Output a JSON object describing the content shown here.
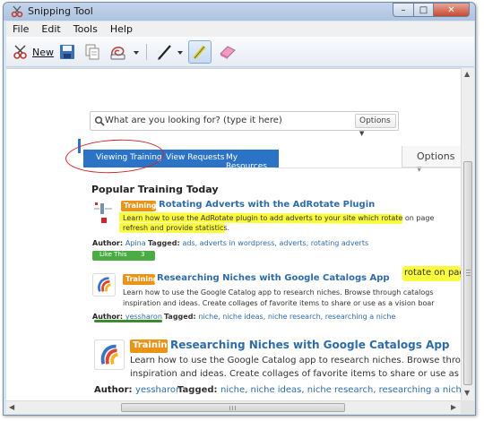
{
  "window": {
    "title": "Snipping Tool"
  },
  "menu": [
    "File",
    "Edit",
    "Tools",
    "Help"
  ],
  "toolbar": {
    "new_label": "New"
  },
  "search": {
    "placeholder": "What are you looking for? (type it here)",
    "options_label": "Options"
  },
  "tabs": [
    "Viewing Training",
    "View Requests",
    "My Resources"
  ],
  "right_options_label": "Options",
  "section_title": "Popular Training Today",
  "trainings": [
    {
      "badge": "Training",
      "title": "Rotating Adverts with the AdRotate Plugin",
      "desc_lines": [
        "Learn how to use the AdRotate plugin to add adverts to your site which rotate on page",
        "refresh and provide statistics."
      ],
      "author_label": "Author:",
      "author": "Apina",
      "tagged_label": "Tagged:",
      "tags": "ads, adverts in wordpress, adverts, rotating adverts",
      "like_label": "Like This",
      "like_count": "3"
    },
    {
      "badge": "Training",
      "title": "Researching Niches with Google Catalogs App",
      "desc_lines": [
        "Learn how to use the Google Catalog app to research niches. Browse through catalogs",
        "inspiration and ideas. Create collages of favorite items to share or use as a vision boar"
      ],
      "author_label": "Author:",
      "author": "yessharon",
      "tagged_label": "Tagged:",
      "tags": "niche, niche ideas, niche research, researching a niche"
    },
    {
      "badge": "Training",
      "title": "Researching Niches with Google Catalogs App",
      "desc_lines": [
        "Learn how to use the Google Catalog app to research niches. Browse through catalo",
        "inspiration and ideas. Create collages of favorite items to share or use as a vision bo"
      ],
      "author_label": "Author:",
      "author": "yessharon",
      "tagged_label": "Tagged:",
      "tags": "niche, niche ideas, niche research, researching a niche"
    }
  ],
  "cut_text": "rotate on page",
  "colors": {
    "accent": "#2a73c7",
    "badge": "#e99317",
    "highlight": "#fbfb3d",
    "link": "#2e6ca8",
    "like_button": "#4bab45",
    "annotation": "#d3232a"
  }
}
